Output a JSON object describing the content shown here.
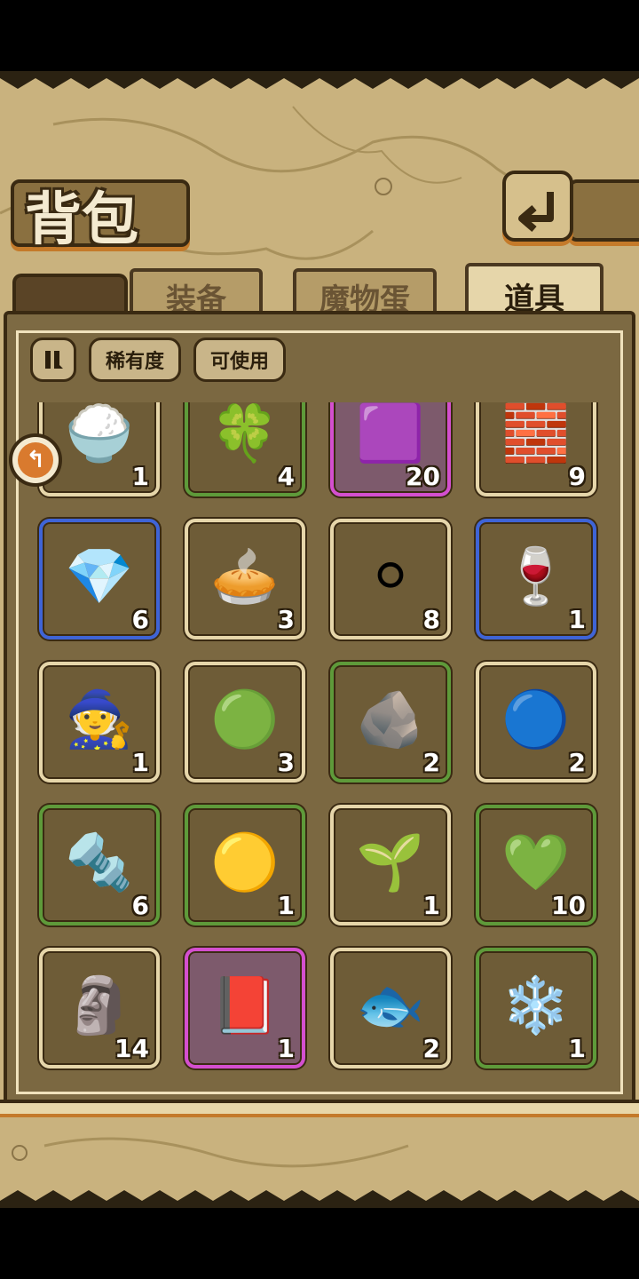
{
  "title": "背包",
  "tabs": [
    {
      "label": "装备",
      "active": false
    },
    {
      "label": "魔物蛋",
      "active": false
    },
    {
      "label": "道具",
      "active": true
    }
  ],
  "filters": {
    "toggle_icon": "pause-list-icon",
    "rarity": "稀有度",
    "usable": "可使用"
  },
  "back_icon": "return-arrow-icon",
  "scroll_icon": "scroll-top-arrow-icon",
  "rarity_colors": {
    "common": "#e6d6aa",
    "green": "#5e9a3a",
    "blue": "#3f64d6",
    "purple": "#d44fcf"
  },
  "items": [
    {
      "name": "white-powder-icon",
      "glyph": "🍚",
      "rarity": "common",
      "count": "1"
    },
    {
      "name": "four-leaf-clover-icon",
      "glyph": "🍀",
      "rarity": "green",
      "count": "4"
    },
    {
      "name": "rainbow-block-icon",
      "glyph": "🟪",
      "rarity": "purple",
      "count": "20"
    },
    {
      "name": "stone-blocks-icon",
      "glyph": "🧱",
      "rarity": "common",
      "count": "9"
    },
    {
      "name": "red-gem-icon",
      "glyph": "💎",
      "rarity": "blue",
      "count": "6"
    },
    {
      "name": "pie-crust-icon",
      "glyph": "🥧",
      "rarity": "common",
      "count": "3"
    },
    {
      "name": "snowball-icon",
      "glyph": "⚪",
      "rarity": "common",
      "count": "8"
    },
    {
      "name": "red-wine-goblet-icon",
      "glyph": "🍷",
      "rarity": "blue",
      "count": "1"
    },
    {
      "name": "wizard-hat-icon",
      "glyph": "🧙",
      "rarity": "common",
      "count": "1"
    },
    {
      "name": "green-slime-icon",
      "glyph": "🟢",
      "rarity": "common",
      "count": "3"
    },
    {
      "name": "fish-fossil-tablet-icon",
      "glyph": "🪨",
      "rarity": "green",
      "count": "2"
    },
    {
      "name": "blue-slime-icon",
      "glyph": "🔵",
      "rarity": "common",
      "count": "2"
    },
    {
      "name": "iron-ingot-icon",
      "glyph": "🔩",
      "rarity": "green",
      "count": "6"
    },
    {
      "name": "yellow-slime-icon",
      "glyph": "🟡",
      "rarity": "green",
      "count": "1"
    },
    {
      "name": "soil-sprout-icon",
      "glyph": "🌱",
      "rarity": "common",
      "count": "1"
    },
    {
      "name": "green-crystal-icon",
      "glyph": "💚",
      "rarity": "green",
      "count": "10"
    },
    {
      "name": "stone-slab-icon",
      "glyph": "🗿",
      "rarity": "common",
      "count": "14"
    },
    {
      "name": "magic-tome-icon",
      "glyph": "📕",
      "rarity": "purple",
      "count": "1"
    },
    {
      "name": "dried-fish-icon",
      "glyph": "🐟",
      "rarity": "common",
      "count": "2"
    },
    {
      "name": "blue-flower-icon",
      "glyph": "❄️",
      "rarity": "green",
      "count": "1"
    }
  ]
}
